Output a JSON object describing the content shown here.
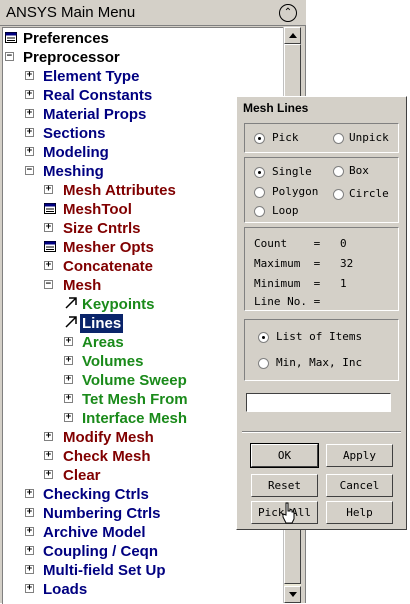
{
  "window": {
    "title": "ANSYS Main Menu",
    "collapse_icon": "double-chevron-up-icon"
  },
  "tree": [
    {
      "label": "Preferences",
      "level": 0,
      "kind": "calc",
      "color": "#000000"
    },
    {
      "label": "Preprocessor",
      "level": 0,
      "kind": "minus",
      "color": "#000000"
    },
    {
      "label": "Element Type",
      "level": 1,
      "kind": "plus",
      "color": "#000080"
    },
    {
      "label": "Real Constants",
      "level": 1,
      "kind": "plus",
      "color": "#000080"
    },
    {
      "label": "Material Props",
      "level": 1,
      "kind": "plus",
      "color": "#000080"
    },
    {
      "label": "Sections",
      "level": 1,
      "kind": "plus",
      "color": "#000080"
    },
    {
      "label": "Modeling",
      "level": 1,
      "kind": "plus",
      "color": "#000080"
    },
    {
      "label": "Meshing",
      "level": 1,
      "kind": "minus",
      "color": "#000080"
    },
    {
      "label": "Mesh Attributes",
      "level": 2,
      "kind": "plus",
      "color": "#800000"
    },
    {
      "label": "MeshTool",
      "level": 2,
      "kind": "calc",
      "color": "#800000"
    },
    {
      "label": "Size Cntrls",
      "level": 2,
      "kind": "plus",
      "color": "#800000"
    },
    {
      "label": "Mesher Opts",
      "level": 2,
      "kind": "calc",
      "color": "#800000"
    },
    {
      "label": "Concatenate",
      "level": 2,
      "kind": "plus",
      "color": "#800000"
    },
    {
      "label": "Mesh",
      "level": 2,
      "kind": "minus",
      "color": "#800000"
    },
    {
      "label": "Keypoints",
      "level": 3,
      "kind": "arrow",
      "color": "#1a8a1a"
    },
    {
      "label": "Lines",
      "level": 3,
      "kind": "arrow",
      "color": "#1a8a1a",
      "selected": true
    },
    {
      "label": "Areas",
      "level": 3,
      "kind": "plus",
      "color": "#1a8a1a"
    },
    {
      "label": "Volumes",
      "level": 3,
      "kind": "plus",
      "color": "#1a8a1a"
    },
    {
      "label": "Volume Sweep",
      "level": 3,
      "kind": "plus",
      "color": "#1a8a1a"
    },
    {
      "label": "Tet Mesh From",
      "level": 3,
      "kind": "plus",
      "color": "#1a8a1a"
    },
    {
      "label": "Interface Mesh",
      "level": 3,
      "kind": "plus",
      "color": "#1a8a1a"
    },
    {
      "label": "Modify Mesh",
      "level": 2,
      "kind": "plus",
      "color": "#800000"
    },
    {
      "label": "Check Mesh",
      "level": 2,
      "kind": "plus",
      "color": "#800000"
    },
    {
      "label": "Clear",
      "level": 2,
      "kind": "plus",
      "color": "#800000"
    },
    {
      "label": "Checking Ctrls",
      "level": 1,
      "kind": "plus",
      "color": "#000080"
    },
    {
      "label": "Numbering Ctrls",
      "level": 1,
      "kind": "plus",
      "color": "#000080"
    },
    {
      "label": "Archive Model",
      "level": 1,
      "kind": "plus",
      "color": "#000080"
    },
    {
      "label": "Coupling / Ceqn",
      "level": 1,
      "kind": "plus",
      "color": "#000080"
    },
    {
      "label": "Multi-field Set Up",
      "level": 1,
      "kind": "plus",
      "color": "#000080"
    },
    {
      "label": "Loads",
      "level": 1,
      "kind": "plus",
      "color": "#000080"
    }
  ],
  "dialog": {
    "title": "Mesh Lines",
    "pick": "Pick",
    "unpick": "Unpick",
    "single": "Single",
    "box": "Box",
    "polygon": "Polygon",
    "circle": "Circle",
    "loop": "Loop",
    "count_label": "Count    =",
    "count_value": "0",
    "maximum_label": "Maximum  =",
    "maximum_value": "32",
    "minimum_label": "Minimum  =",
    "minimum_value": "1",
    "lineno_label": "Line No. =",
    "list_of_items": "List of Items",
    "min_max_inc": "Min, Max, Inc",
    "input_value": "",
    "buttons": {
      "ok": "OK",
      "apply": "Apply",
      "reset": "Reset",
      "cancel": "Cancel",
      "pick_all": "Pick All",
      "help": "Help"
    }
  }
}
